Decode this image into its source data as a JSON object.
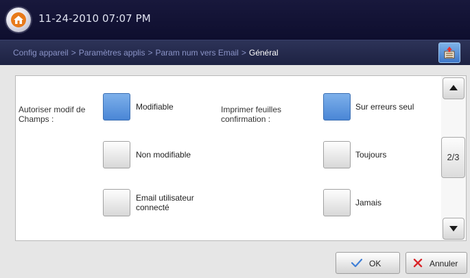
{
  "header": {
    "datetime": "11-24-2010 07:07 PM"
  },
  "breadcrumb": {
    "items": [
      "Config appareil",
      "Paramètres applis",
      "Param num vers Email",
      "Général"
    ],
    "separator": ">"
  },
  "settings": {
    "left": {
      "label": "Autoriser modif de Champs :",
      "options": [
        {
          "label": "Modifiable",
          "selected": true
        },
        {
          "label": "Non modifiable",
          "selected": false
        },
        {
          "label": "Email utilisateur connecté",
          "selected": false
        }
      ]
    },
    "right": {
      "label": "Imprimer feuilles confirmation :",
      "options": [
        {
          "label": "Sur erreurs seul",
          "selected": true
        },
        {
          "label": "Toujours",
          "selected": false
        },
        {
          "label": "Jamais",
          "selected": false
        }
      ]
    }
  },
  "pager": {
    "indicator": "2/3"
  },
  "footer": {
    "ok_label": "OK",
    "cancel_label": "Annuler"
  },
  "colors": {
    "selected": "#5a93dd",
    "ok_check": "#3f7fd6",
    "cancel_x": "#d9262a"
  }
}
